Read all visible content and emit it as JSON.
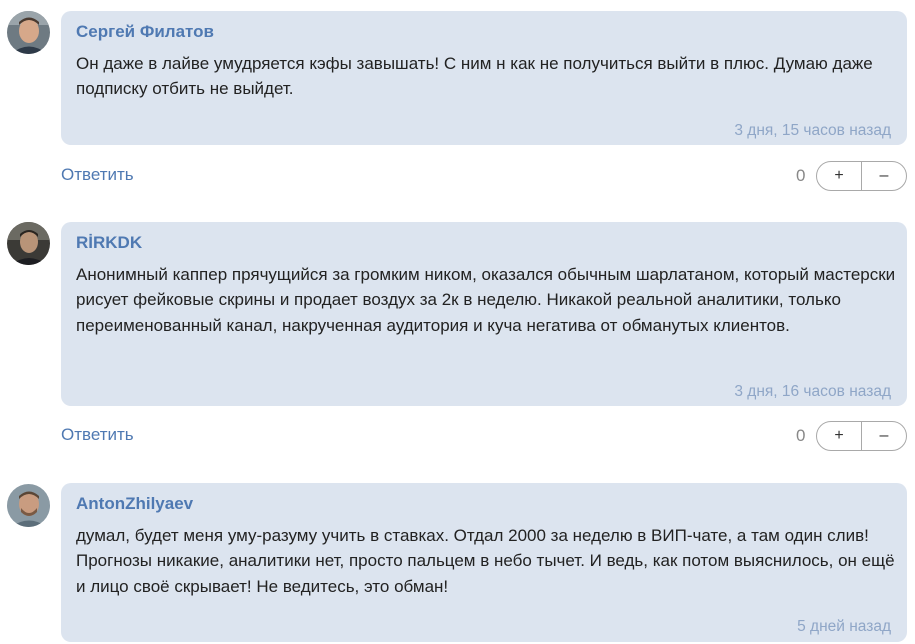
{
  "comments": [
    {
      "author": "Сергей Филатов",
      "text": "Он даже в лайве умудряется кэфы завышать! С ним н как не получиться выйти в плюс. Думаю даже подписку отбить не выйдет.",
      "time": "3 дня, 15 часов назад",
      "reply_label": "Ответить",
      "score": "0",
      "upvote_label": "+",
      "downvote_label": "–"
    },
    {
      "author": "RİRKDK",
      "text": "Анонимный каппер прячущийся за громким ником, оказался обычным шарлатаном, который мастерски рисует фейковые скрины и продает воздух за 2к в неделю. Никакой реальной аналитики, только переименованный канал, накрученная аудитория и куча негатива от обманутых клиентов.",
      "time": "3 дня, 16 часов назад",
      "reply_label": "Ответить",
      "score": "0",
      "upvote_label": "+",
      "downvote_label": "–"
    },
    {
      "author": "AntonZhilyaev",
      "text": "думал, будет меня уму-разуму учить в ставках. Отдал 2000 за неделю в ВИП-чате, а там один слив! Прогнозы никакие, аналитики нет, просто пальцем в небо тычет. И ведь, как потом выяснилось, он ещё и лицо своё скрывает! Не ведитесь, это обман!",
      "time": "5 дней назад"
    }
  ]
}
